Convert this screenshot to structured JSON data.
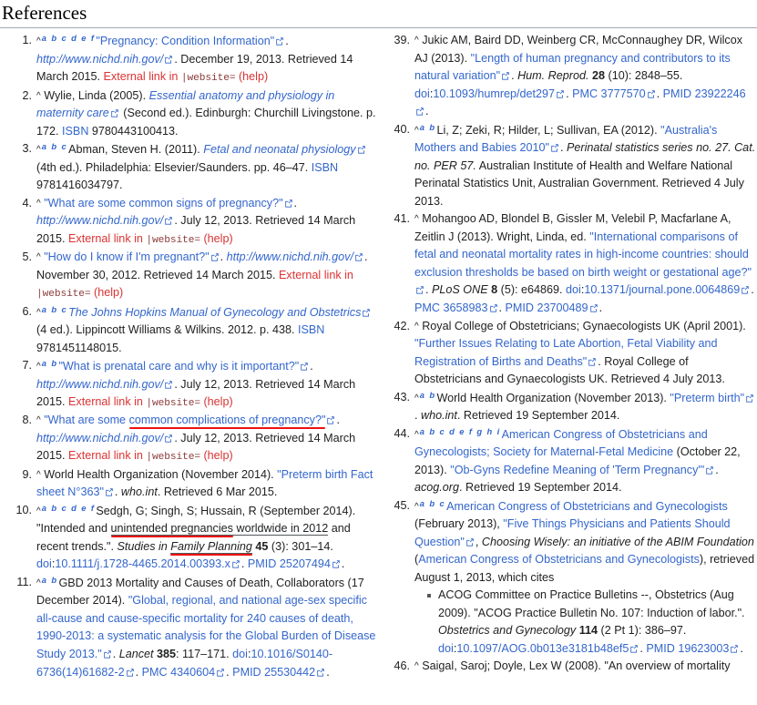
{
  "page": {
    "heading": "References",
    "external_link_icon_name": "external-link-icon"
  },
  "error_strings": {
    "external_link_in": "External link in ",
    "param_website": "|website=",
    "help": "(help)"
  },
  "left_column": [
    {
      "num": "1.",
      "backlinks": "a b c d e f",
      "title": "\"Pregnancy: Condition Information\"",
      "work": "http://www.nichd.nih.gov/",
      "date": ". December 19, 2013. Retrieved 14 March 2015. ",
      "error": true
    },
    {
      "num": "2.",
      "backlinks": "",
      "author": "Wylie, Linda (2005). ",
      "title_italic": "Essential anatomy and physiology in maternity care",
      "rest": " (Second ed.). Edinburgh: Churchill Livingstone. p. 172. ",
      "isbn_label": "ISBN",
      "isbn": " 9780443100413."
    },
    {
      "num": "3.",
      "backlinks": "a b c",
      "author": "Abman, Steven H. (2011). ",
      "title_italic": "Fetal and neonatal physiology",
      "rest": " (4th ed.). Philadelphia: Elsevier/Saunders. pp. 46–47. ",
      "isbn_label": "ISBN",
      "isbn": " 9781416034797."
    },
    {
      "num": "4.",
      "backlinks": "",
      "title": "\"What are some common signs of pregnancy?\"",
      "work": "http://www.nichd.nih.gov/",
      "date": ". July 12, 2013. Retrieved 14 March 2015. ",
      "error": true
    },
    {
      "num": "5.",
      "backlinks": "",
      "title": "\"How do I know if I'm pregnant?\"",
      "work": "http://www.nichd.nih.gov/",
      "date": ". November 30, 2012. Retrieved 14 March 2015. ",
      "error": true
    },
    {
      "num": "6.",
      "backlinks": "a b c",
      "title_italic": "The Johns Hopkins Manual of Gynecology and Obstetrics",
      "rest": " (4 ed.). Lippincott Williams & Wilkins. 2012. p. 438. ",
      "isbn_label": "ISBN",
      "isbn": " 9781451148015."
    },
    {
      "num": "7.",
      "backlinks": "a b",
      "title": "\"What is prenatal care and why is it important?\"",
      "work": "http://www.nichd.nih.gov/",
      "date": ". July 12, 2013. Retrieved 14 March 2015. ",
      "error": true
    },
    {
      "num": "8.",
      "backlinks": "",
      "title_prefix": "\"What are some ",
      "title_highlight": "common complications of pregnancy?\"",
      "work": "http://www.nichd.nih.gov/",
      "date": ". July 12, 2013. Retrieved 14 March 2015. ",
      "error": true
    },
    {
      "num": "9.",
      "backlinks": "",
      "author": "World Health Organization (November 2014). ",
      "title": "\"Preterm birth Fact sheet N°363\"",
      "work_italic": "who.int",
      "rest": ". Retrieved 6 Mar 2015."
    },
    {
      "num": "10.",
      "backlinks": "a b c d e f",
      "author": "Sedgh, G; Singh, S; Hussain, R (September 2014). ",
      "quote_prefix": "\"Intended and ",
      "quote_highlight": "unintended pregnancies",
      "quote_underline": " worldwide in 2012",
      "quote_suffix": " and recent trends.\". ",
      "journal": "Studies in ",
      "journal_highlight": "Family Planning",
      "vol": " 45",
      "issue": " (3): 301–14. ",
      "doi_label": "doi",
      "doi": "10.1111/j.1728-4465.2014.00393.x",
      "pmid_label": "PMID",
      "pmid": " 25207494"
    },
    {
      "num": "11.",
      "backlinks": "a b",
      "author": "GBD 2013 Mortality and Causes of Death, Collaborators (17 December 2014). ",
      "title": "\"Global, regional, and national age-sex specific all-cause and cause-specific mortality for 240 causes of death, 1990-2013: a systematic analysis for the Global Burden of Disease Study 2013.\"",
      "journal_italic": "Lancet",
      "vol": " 385",
      "pages": ": 117–171. ",
      "doi_label": "doi",
      "doi": "10.1016/S0140-6736(14)61682-2",
      "pmc_label": "PMC",
      "pmc": " 4340604",
      "pmid_label": "PMID",
      "pmid": " 25530442"
    }
  ],
  "right_column": [
    {
      "num": "39.",
      "backlinks": "",
      "author": "Jukic AM, Baird DD, Weinberg CR, McConnaughey DR, Wilcox AJ (2013). ",
      "title": "\"Length of human pregnancy and contributors to its natural variation\"",
      "journal_italic": "Hum. Reprod.",
      "vol": " 28",
      "issue": " (10): 2848–55. ",
      "doi_label": "doi",
      "doi": "10.1093/humrep/det297",
      "pmc_label": "PMC",
      "pmc": " 3777570",
      "pmid_label": "PMID",
      "pmid": " 23922246"
    },
    {
      "num": "40.",
      "backlinks": "a b",
      "author": "Li, Z; Zeki, R; Hilder, L; Sullivan, EA (2012). ",
      "title": "\"Australia's Mothers and Babies 2010\"",
      "series_italic": "Perinatal statistics series no. 27. Cat. no. PER 57.",
      "rest": " Australian Institute of Health and Welfare National Perinatal Statistics Unit, Australian Government. Retrieved 4 July 2013."
    },
    {
      "num": "41.",
      "backlinks": "",
      "author": "Mohangoo AD, Blondel B, Gissler M, Velebil P, Macfarlane A, Zeitlin J (2013). Wright, Linda, ed. ",
      "title": "\"International comparisons of fetal and neonatal mortality rates in high-income countries: should exclusion thresholds be based on birth weight or gestational age?\"",
      "journal_italic": "PLoS ONE",
      "vol": " 8",
      "issue": " (5): e64869. ",
      "doi_label": "doi",
      "doi": "10.1371/journal.pone.0064869",
      "pmc_label": "PMC",
      "pmc": " 3658983",
      "pmid_label": "PMID",
      "pmid": " 23700489"
    },
    {
      "num": "42.",
      "backlinks": "",
      "author": "Royal College of Obstetricians; Gynaecologists UK (April 2001). ",
      "title": "\"Further Issues Relating to Late Abortion, Fetal Viability and Registration of Births and Deaths\"",
      "rest": ". Royal College of Obstetricians and Gynaecologists UK. Retrieved 4 July 2013."
    },
    {
      "num": "43.",
      "backlinks": "a b",
      "author": "World Health Organization (November 2013). ",
      "title": "\"Preterm birth\"",
      "work_italic": "who.int",
      "rest": ". Retrieved 19 September 2014."
    },
    {
      "num": "44.",
      "backlinks": "a b c d e f g h i",
      "author_link": "American Congress of Obstetricians and Gynecologists; Society for Maternal-Fetal Medicine",
      "author_rest": " (October 22, 2013). ",
      "title": "\"Ob-Gyns Redefine Meaning of 'Term Pregnancy'\"",
      "work_italic": "acog.org",
      "rest": ". Retrieved 19 September 2014."
    },
    {
      "num": "45.",
      "backlinks": "a b c",
      "author_link": "American Congress of Obstetricians and Gynecologists",
      "author_rest": " (February 2013), ",
      "title": "\"Five Things Physicians and Patients Should Question\"",
      "work_italic": "Choosing Wisely: an initiative of the ABIM Foundation",
      "publisher_link": "American Congress of Obstetricians and Gynecologists",
      "rest": "), retrieved August 1, 2013, which cites",
      "sub": [
        {
          "text_1": "ACOG Committee on Practice Bulletins --, Obstetrics (Aug 2009). \"ACOG Practice Bulletin No. 107: Induction of labor.\". ",
          "journal_italic": "Obstetrics and Gynecology",
          "vol": " 114",
          "issue": " (2 Pt 1): 386–97. ",
          "doi_label": "doi",
          "doi": "10.1097/AOG.0b013e3181b48ef5",
          "pmid_label": "PMID",
          "pmid": " 19623003"
        }
      ]
    },
    {
      "num": "46.",
      "backlinks": "",
      "author": "Saigal, Saroj; Doyle, Lex W (2008). \"An overview of mortality"
    }
  ],
  "colors": {
    "link": "#3366cc",
    "text": "#202122",
    "error": "#d33",
    "code": "#8b3a3a",
    "help": "#d73333",
    "highlight": "#ee1111",
    "rule": "#a2a9b1"
  }
}
